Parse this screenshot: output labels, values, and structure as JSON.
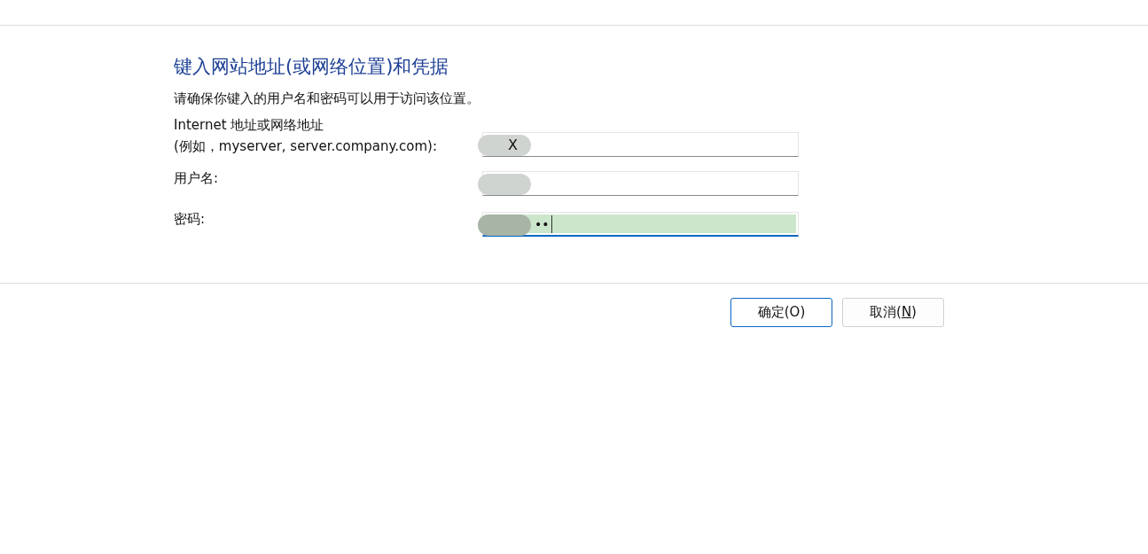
{
  "title": "键入网站地址(或网络位置)和凭据",
  "instruction": "请确保你键入的用户名和密码可以用于访问该位置。",
  "fields": [
    {
      "kind": "text",
      "label_lines": [
        "Internet 地址或网络地址",
        "(例如，myserver, server.company.com):"
      ],
      "value": "X",
      "redacted": true,
      "focused": false
    },
    {
      "kind": "text",
      "label_lines": [
        "用户名:"
      ],
      "redacted": true,
      "focused": false
    },
    {
      "kind": "password",
      "label_lines": [
        "密码:"
      ],
      "value": "••",
      "redacted": true,
      "focused": true
    }
  ],
  "buttons": [
    {
      "label": "确定(O)",
      "default": true
    },
    {
      "label_start": "取消(",
      "mnemonic": "N",
      "label_end": ")",
      "default": false
    }
  ]
}
